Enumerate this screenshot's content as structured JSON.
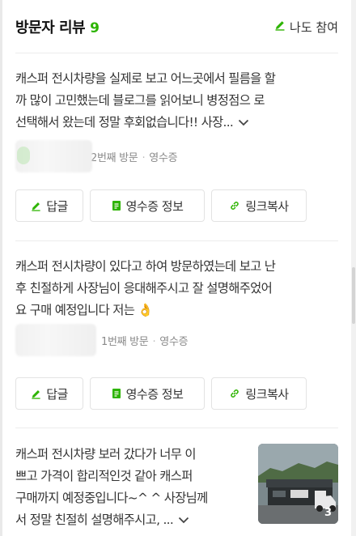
{
  "header": {
    "title": "방문자 리뷰",
    "count": "9",
    "join_label": "나도 참여"
  },
  "reviews": [
    {
      "lines": [
        "캐스퍼 전시차량을 실제로 보고 어느곳에서 필름을 할",
        "까 많이 고민했는데 블로그를 읽어보니 병정점으 로",
        "선택해서 왔는데 정말 후회없습니다!! 사장..."
      ],
      "visit": "2번째 방문",
      "receipt": "영수증"
    },
    {
      "lines": [
        "캐스퍼 전시차량이 있다고 하여 방문하였는데 보고 난",
        "후 친절하게 사장님이 응대해주시고 잘 설명해주었어",
        "요 구매 예정입니다 저는"
      ],
      "emoji": "👌",
      "visit": "1번째 방문",
      "receipt": "영수증"
    },
    {
      "lines": [
        "캐스퍼 전시차량 보러 갔다가 너무 이",
        "쁘고 가격이 합리적인것 같아 캐스퍼",
        "구매까지 예정중입니다~^ ^ 사장님께",
        "서 정말 친절히 설명해주시고, ..."
      ],
      "photo_count": "3"
    }
  ],
  "buttons": {
    "reply": "답글",
    "receipt_info": "영수증 정보",
    "copy_link": "링크복사"
  },
  "colors": {
    "accent": "#2db400",
    "border": "#e3e3e3",
    "divider": "#ececec"
  }
}
